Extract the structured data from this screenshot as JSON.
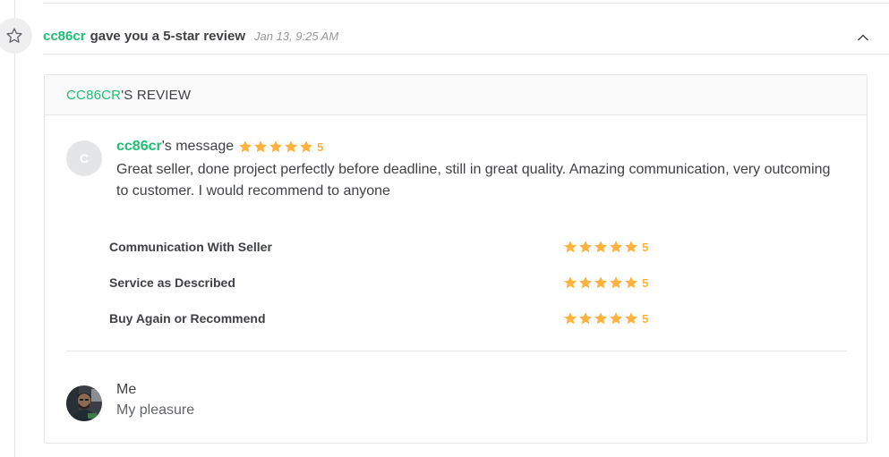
{
  "notification": {
    "reviewer": "cc86cr",
    "action_text": "gave you a 5-star review",
    "timestamp": "Jan 13, 9:25 AM"
  },
  "review_card": {
    "header_name": "CC86CR",
    "header_suffix": "'S REVIEW",
    "reviewer": "cc86cr",
    "message_suffix": "'s message",
    "overall_rating": "5",
    "message": "Great seller, done project perfectly before deadline, still in great quality. Amazing communication, very outcoming to customer. I would recommend to anyone",
    "ratings": [
      {
        "label": "Communication With Seller",
        "score": "5"
      },
      {
        "label": "Service as Described",
        "score": "5"
      },
      {
        "label": "Buy Again or Recommend",
        "score": "5"
      }
    ],
    "reply": {
      "author": "Me",
      "text": "My pleasure"
    }
  },
  "avatar_initial": "C",
  "colors": {
    "brand_green": "#1dbf73",
    "star": "#ffb33e",
    "text_dark": "#404145",
    "text_muted": "#62646a",
    "border": "#e4e5e7"
  },
  "icons": {
    "timeline": "star-outline-icon",
    "collapse": "chevron-up-icon",
    "rating": "star-filled-icon"
  }
}
